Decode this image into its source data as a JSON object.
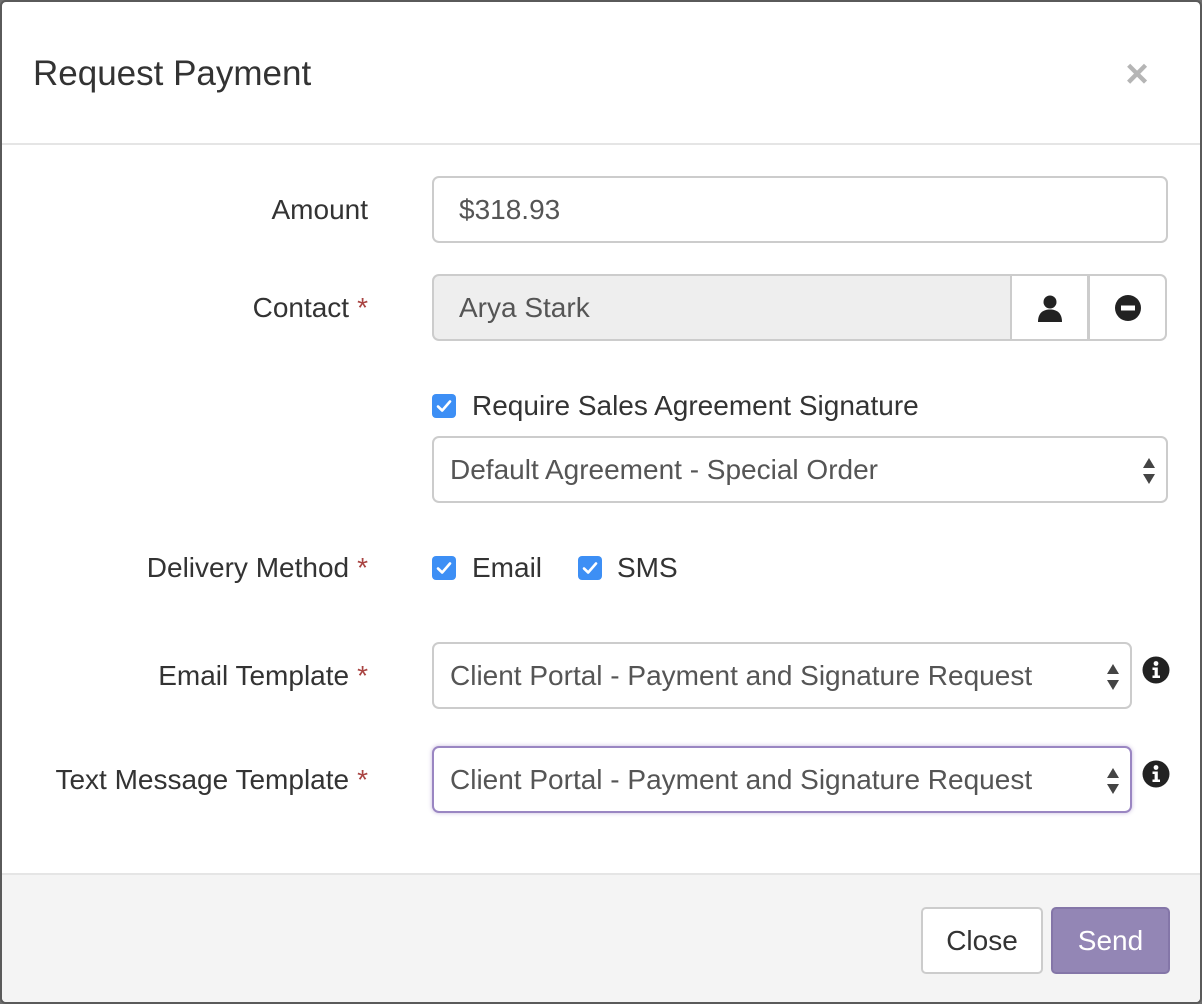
{
  "modal": {
    "title": "Request Payment",
    "close_glyph": "×"
  },
  "form": {
    "amount": {
      "label": "Amount",
      "value": "$318.93"
    },
    "contact": {
      "label": "Contact",
      "required_marker": "*",
      "value": "Arya Stark",
      "select_icon": "user-icon",
      "clear_icon": "minus-circle-icon"
    },
    "agreement": {
      "checkbox_label": "Require Sales Agreement Signature",
      "checked": true,
      "selected": "Default Agreement - Special Order"
    },
    "delivery": {
      "label": "Delivery Method",
      "required_marker": "*",
      "email_label": "Email",
      "email_checked": true,
      "sms_label": "SMS",
      "sms_checked": true
    },
    "email_template": {
      "label": "Email Template",
      "required_marker": "*",
      "selected": "Client Portal - Payment and Signature Request",
      "info_icon": "info-icon"
    },
    "text_template": {
      "label": "Text Message Template",
      "required_marker": "*",
      "selected": "Client Portal - Payment and Signature Request",
      "info_icon": "info-icon"
    }
  },
  "footer": {
    "close_label": "Close",
    "send_label": "Send"
  },
  "colors": {
    "required": "#a94442",
    "checkbox": "#3d8ff5",
    "primary_button": "#9386b5",
    "focus_border": "#9a86c2"
  }
}
